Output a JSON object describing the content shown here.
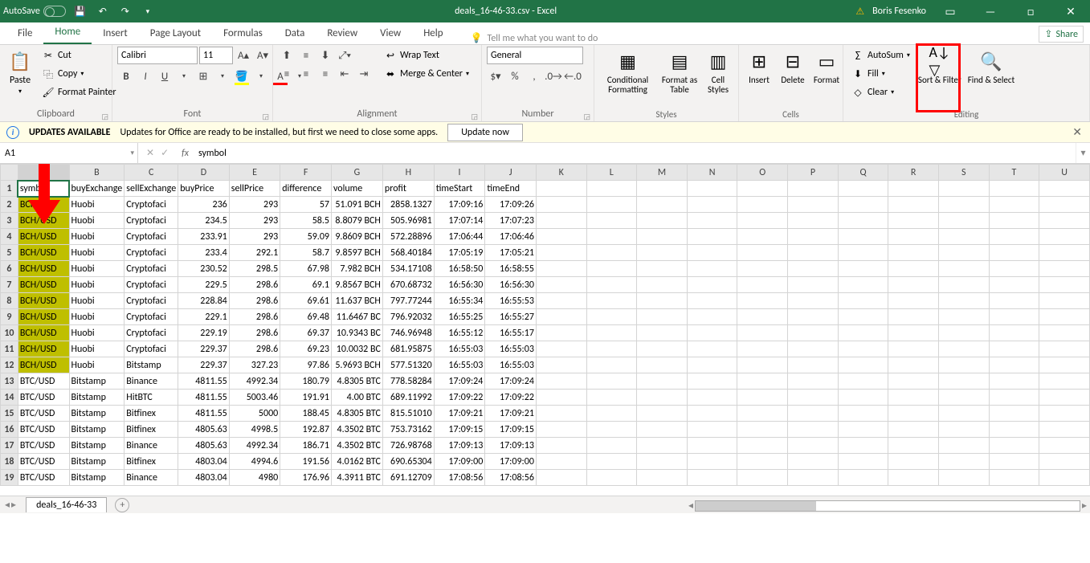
{
  "titlebar": {
    "autosave": "AutoSave",
    "title": "deals_16-46-33.csv  -  Excel",
    "user": "Boris Fesenko"
  },
  "tabs": {
    "file": "File",
    "home": "Home",
    "insert": "Insert",
    "page_layout": "Page Layout",
    "formulas": "Formulas",
    "data": "Data",
    "review": "Review",
    "view": "View",
    "help": "Help",
    "tellme": "Tell me what you want to do",
    "share": "Share"
  },
  "ribbon": {
    "clipboard": {
      "label": "Clipboard",
      "paste": "Paste",
      "cut": "Cut",
      "copy": "Copy",
      "format_painter": "Format Painter"
    },
    "font": {
      "label": "Font",
      "name": "Calibri",
      "size": "11"
    },
    "alignment": {
      "label": "Alignment",
      "wrap": "Wrap Text",
      "merge": "Merge & Center"
    },
    "number": {
      "label": "Number",
      "format": "General"
    },
    "styles": {
      "label": "Styles",
      "cond": "Conditional Formatting",
      "table": "Format as Table",
      "cell": "Cell Styles"
    },
    "cells": {
      "label": "Cells",
      "insert": "Insert",
      "delete": "Delete",
      "format": "Format"
    },
    "editing": {
      "label": "Editing",
      "autosum": "AutoSum",
      "fill": "Fill",
      "clear": "Clear",
      "sort": "Sort & Filter",
      "find": "Find & Select"
    }
  },
  "msgbar": {
    "title": "UPDATES AVAILABLE",
    "text": "Updates for Office are ready to be installed, but first we need to close some apps.",
    "button": "Update now"
  },
  "formula": {
    "cell": "A1",
    "value": "symbol"
  },
  "columns": [
    "A",
    "B",
    "C",
    "D",
    "E",
    "F",
    "G",
    "H",
    "I",
    "J",
    "K",
    "L",
    "M",
    "N",
    "O",
    "P",
    "Q",
    "R",
    "S",
    "T",
    "U"
  ],
  "headers": [
    "symbol",
    "buyExchange",
    "sellExchange",
    "buyPrice",
    "sellPrice",
    "difference",
    "volume",
    "profit",
    "timeStart",
    "timeEnd"
  ],
  "rows": [
    [
      "BCH/USD",
      "Huobi",
      "Cryptofaci",
      "236",
      "293",
      "57",
      "51.091 BCH",
      "2858.1327",
      "17:09:16",
      "17:09:26"
    ],
    [
      "BCH/USD",
      "Huobi",
      "Cryptofaci",
      "234.5",
      "293",
      "58.5",
      "8.8079 BCH",
      "505.96981",
      "17:07:14",
      "17:07:23"
    ],
    [
      "BCH/USD",
      "Huobi",
      "Cryptofaci",
      "233.91",
      "293",
      "59.09",
      "9.8609 BCH",
      "572.28896",
      "17:06:44",
      "17:06:46"
    ],
    [
      "BCH/USD",
      "Huobi",
      "Cryptofaci",
      "233.4",
      "292.1",
      "58.7",
      "9.8597 BCH",
      "568.40184",
      "17:05:19",
      "17:05:21"
    ],
    [
      "BCH/USD",
      "Huobi",
      "Cryptofaci",
      "230.52",
      "298.5",
      "67.98",
      "7.982 BCH",
      "534.17108",
      "16:58:50",
      "16:58:55"
    ],
    [
      "BCH/USD",
      "Huobi",
      "Cryptofaci",
      "229.5",
      "298.6",
      "69.1",
      "9.8567 BCH",
      "670.68732",
      "16:56:30",
      "16:56:30"
    ],
    [
      "BCH/USD",
      "Huobi",
      "Cryptofaci",
      "228.84",
      "298.6",
      "69.61",
      "11.637 BCH",
      "797.77244",
      "16:55:34",
      "16:55:53"
    ],
    [
      "BCH/USD",
      "Huobi",
      "Cryptofaci",
      "229.1",
      "298.6",
      "69.48",
      "11.6467 BC",
      "796.92032",
      "16:55:25",
      "16:55:27"
    ],
    [
      "BCH/USD",
      "Huobi",
      "Cryptofaci",
      "229.19",
      "298.6",
      "69.37",
      "10.9343 BC",
      "746.96948",
      "16:55:12",
      "16:55:17"
    ],
    [
      "BCH/USD",
      "Huobi",
      "Cryptofaci",
      "229.37",
      "298.6",
      "69.23",
      "10.0032 BC",
      "681.95875",
      "16:55:03",
      "16:55:03"
    ],
    [
      "BCH/USD",
      "Huobi",
      "Bitstamp",
      "229.37",
      "327.23",
      "97.86",
      "5.9693 BCH",
      "577.51320",
      "16:55:03",
      "16:55:03"
    ],
    [
      "BTC/USD",
      "Bitstamp",
      "Binance",
      "4811.55",
      "4992.34",
      "180.79",
      "4.8305 BTC",
      "778.58284",
      "17:09:24",
      "17:09:24"
    ],
    [
      "BTC/USD",
      "Bitstamp",
      "HitBTC",
      "4811.55",
      "5003.46",
      "191.91",
      "4.00 BTC",
      "689.11992",
      "17:09:22",
      "17:09:22"
    ],
    [
      "BTC/USD",
      "Bitstamp",
      "Bitfinex",
      "4811.55",
      "5000",
      "188.45",
      "4.8305 BTC",
      "815.51010",
      "17:09:21",
      "17:09:21"
    ],
    [
      "BTC/USD",
      "Bitstamp",
      "Bitfinex",
      "4805.63",
      "4998.5",
      "192.87",
      "4.3502 BTC",
      "753.73162",
      "17:09:15",
      "17:09:15"
    ],
    [
      "BTC/USD",
      "Bitstamp",
      "Binance",
      "4805.63",
      "4992.34",
      "186.71",
      "4.3502 BTC",
      "726.98768",
      "17:09:13",
      "17:09:13"
    ],
    [
      "BTC/USD",
      "Bitstamp",
      "Bitfinex",
      "4803.04",
      "4994.6",
      "191.56",
      "4.0162 BTC",
      "690.65304",
      "17:09:00",
      "17:09:00"
    ],
    [
      "BTC/USD",
      "Bitstamp",
      "Binance",
      "4803.04",
      "4980",
      "176.96",
      "4.3911 BTC",
      "691.12709",
      "17:08:56",
      "17:08:56"
    ]
  ],
  "sheet": {
    "name": "deals_16-46-33"
  }
}
